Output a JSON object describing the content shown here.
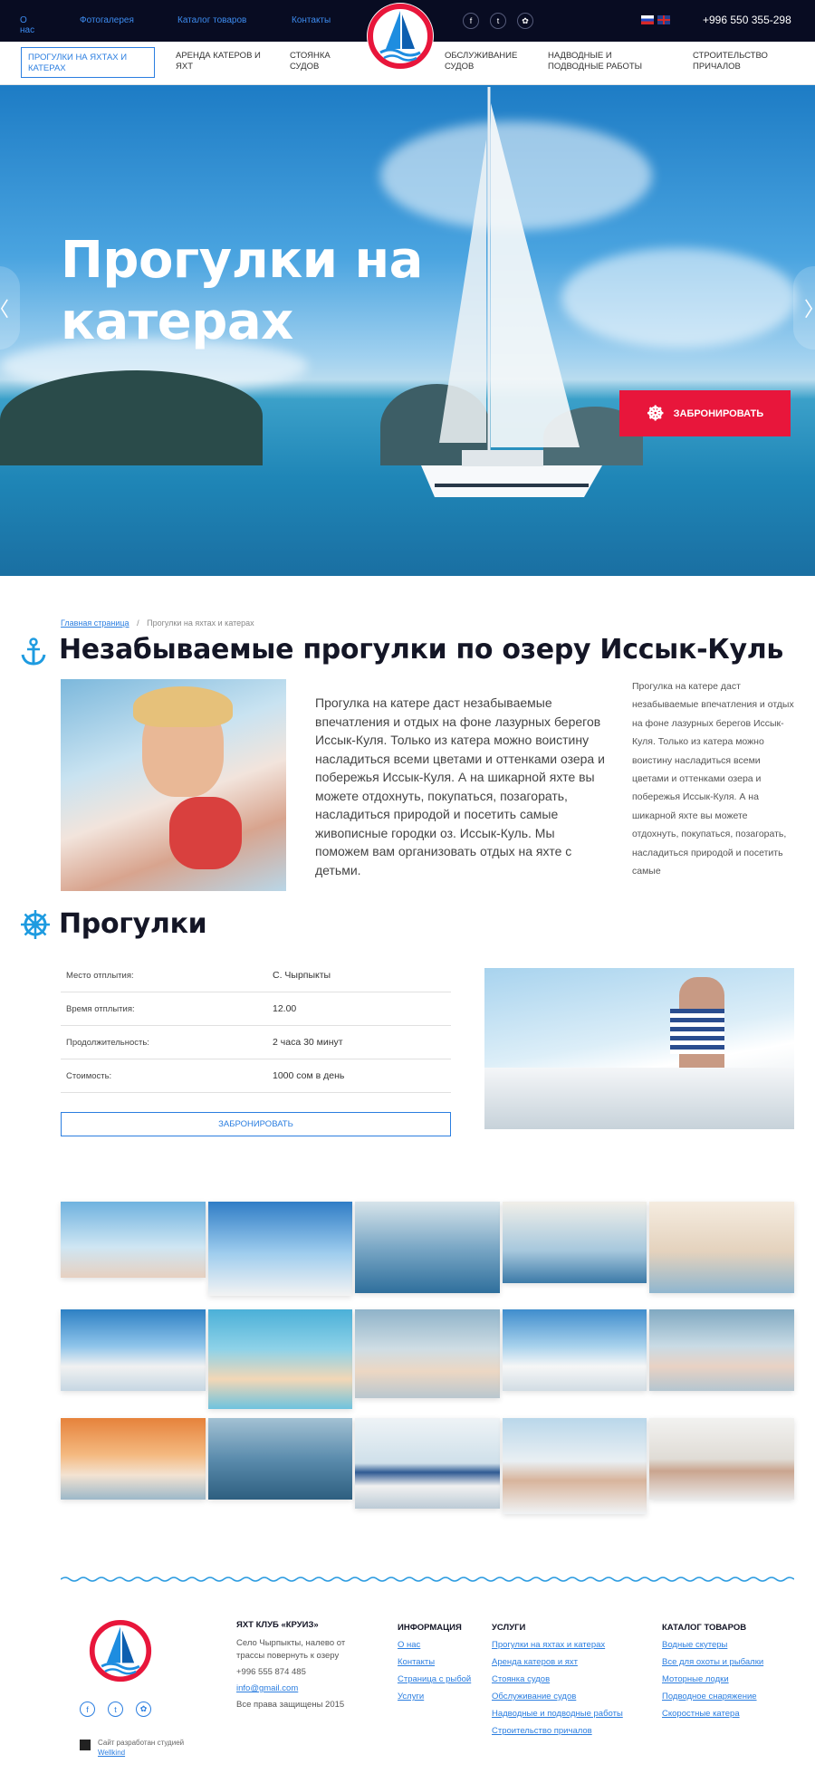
{
  "topbar": {
    "links": [
      "О нас",
      "Фотогалерея",
      "Каталог товаров",
      "Контакты"
    ],
    "social": [
      "f",
      "t",
      "ok"
    ],
    "phone": "+996 550 355-298"
  },
  "logo": {
    "text": "ЯХТ КЛУБ «КРУИЗ»"
  },
  "nav": {
    "items": [
      "ПРОГУЛКИ НА ЯХТАХ И КАТЕРАХ",
      "АРЕНДА КАТЕРОВ И ЯХТ",
      "СТОЯНКА СУДОВ",
      "ОБСЛУЖИВАНИЕ СУДОВ",
      "НАДВОДНЫЕ И ПОДВОДНЫЕ РАБОТЫ",
      "СТРОИТЕЛЬСТВО ПРИЧАЛОВ"
    ]
  },
  "hero": {
    "title_line1": "Прогулки на",
    "title_line2": "катерах",
    "book_label": "ЗАБРОНИРОВАТЬ",
    "prev": "〈",
    "next": "〉"
  },
  "breadcrumb": {
    "home": "Главная страница",
    "sep": "/",
    "current": "Прогулки на яхтах и катерах"
  },
  "section1": {
    "title": "Незабываемые прогулки по озеру Иссык-Куль",
    "lead": "Прогулка на катере даст незабываемые впечатления и отдых на фоне лазурных берегов Иссык-Куля. Только из катера можно воистину насладиться всеми цветами и оттенками озера и побережья Иссык-Куля. А на шикарной яхте вы можете отдохнуть, покупаться, позагорать, насладиться природой и посетить самые живописные городки оз. Иссык-Куль. Мы поможем вам организовать отдых на яхте с детьми.",
    "side": "Прогулка на катере даст незабываемые впечатления и отдых на фоне лазурных берегов Иссык-Куля. Только из катера можно воистину насладиться всеми цветами и оттенками озера и побережья Иссык-Куля. А на шикарной яхте вы можете отдохнуть, покупаться, позагорать, насладиться природой и посетить самые"
  },
  "section2": {
    "title": "Прогулки",
    "rows": [
      {
        "key": "Место отплытия:",
        "value": "С. Чырпыкты"
      },
      {
        "key": "Время отплытия:",
        "value": "12.00"
      },
      {
        "key": "Продолжительность:",
        "value": "2 часа 30 минут"
      },
      {
        "key": "Стоимость:",
        "value": "1000 сом в день"
      }
    ],
    "book_label": "ЗАБРОНИРОВАТЬ"
  },
  "footer": {
    "club_title": "ЯХТ КЛУБ «КРУИЗ»",
    "address": "Село Чырпыкты, налево от трассы повернуть к озеру",
    "phone": "+996 555 874 485",
    "email": "info@gmail.com",
    "rights": "Все права защищены 2015",
    "info_head": "ИНФОРМАЦИЯ",
    "info_links": [
      "О нас",
      "Контакты",
      "Страница с рыбой",
      "Услуги"
    ],
    "services_head": "УСЛУГИ",
    "services_links": [
      "Прогулки на яхтах и катерах",
      "Аренда катеров и яхт",
      "Стоянка судов",
      "Обслуживание судов",
      "Надводные и подводные работы",
      "Строительство причалов"
    ],
    "catalog_head": "КАТАЛОГ ТОВАРОВ",
    "catalog_links": [
      "Водные скутеры",
      "Все для охоты и рыбалки",
      "Моторные лодки",
      "Подводное снаряжение",
      "Скоростные катера"
    ],
    "studio_text": "Сайт разработан студией",
    "studio_link": "Wellkind"
  },
  "colors": {
    "accent": "#2b7ee0",
    "book": "#e8163b",
    "topbar": "#080c22"
  }
}
